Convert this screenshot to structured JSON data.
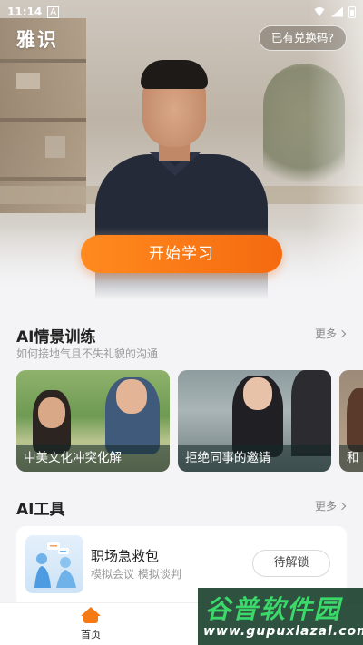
{
  "status_bar": {
    "time": "11:14",
    "notification": "A"
  },
  "header": {
    "app_title": "雅识",
    "redeem_label": "已有兑换码?"
  },
  "hero": {
    "start_label": "开始学习"
  },
  "scenario_section": {
    "title": "AI情景训练",
    "subtitle": "如何接地气且不失礼貌的沟通",
    "more_label": "更多",
    "cards": [
      {
        "label": "中美文化冲突化解"
      },
      {
        "label": "拒绝同事的邀请"
      },
      {
        "label": "和"
      }
    ]
  },
  "tools_section": {
    "title": "AI工具",
    "more_label": "更多",
    "items": [
      {
        "title": "职场急救包",
        "subtitle": "模拟会议 模拟谈判",
        "action_label": "待解锁"
      }
    ]
  },
  "bottom_nav": {
    "items": [
      {
        "label": "首页",
        "icon": "home-icon",
        "active": true
      }
    ]
  },
  "watermark": {
    "title": "谷普软件园",
    "url": "www.gupuxlazal.com"
  },
  "colors": {
    "accent": "#f57a14",
    "accent_gradient_end": "#f56a10"
  }
}
